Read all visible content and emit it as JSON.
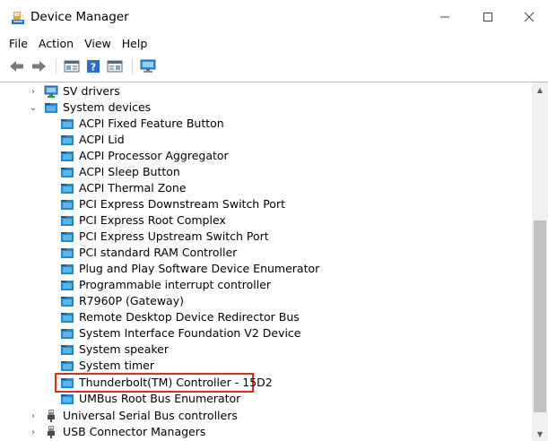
{
  "window": {
    "title": "Device Manager",
    "controls": {
      "minimize": "—",
      "maximize": "☐",
      "close": "✕"
    }
  },
  "menu": {
    "items": [
      "File",
      "Action",
      "View",
      "Help"
    ]
  },
  "toolbar": {
    "buttons": [
      "back-icon",
      "forward-icon",
      "properties-icon",
      "help-icon",
      "console-icon",
      "monitor-icon"
    ]
  },
  "tree": {
    "rows": [
      {
        "label": "SV drivers",
        "level": 0,
        "expander": "collapsed",
        "icon": "monitor-icon"
      },
      {
        "label": "System devices",
        "level": 0,
        "expander": "expanded",
        "icon": "folder-device-icon"
      },
      {
        "label": "ACPI Fixed Feature Button",
        "level": 1,
        "icon": "device-icon"
      },
      {
        "label": "ACPI Lid",
        "level": 1,
        "icon": "device-icon"
      },
      {
        "label": "ACPI Processor Aggregator",
        "level": 1,
        "icon": "device-icon"
      },
      {
        "label": "ACPI Sleep Button",
        "level": 1,
        "icon": "device-icon"
      },
      {
        "label": "ACPI Thermal Zone",
        "level": 1,
        "icon": "device-icon"
      },
      {
        "label": "PCI Express Downstream Switch Port",
        "level": 1,
        "icon": "device-icon"
      },
      {
        "label": "PCI Express Root Complex",
        "level": 1,
        "icon": "device-icon"
      },
      {
        "label": "PCI Express Upstream Switch Port",
        "level": 1,
        "icon": "device-icon"
      },
      {
        "label": "PCI standard RAM Controller",
        "level": 1,
        "icon": "device-icon"
      },
      {
        "label": "Plug and Play Software Device Enumerator",
        "level": 1,
        "icon": "device-icon"
      },
      {
        "label": "Programmable interrupt controller",
        "level": 1,
        "icon": "device-icon"
      },
      {
        "label": "R7960P (Gateway)",
        "level": 1,
        "icon": "device-icon"
      },
      {
        "label": "Remote Desktop Device Redirector Bus",
        "level": 1,
        "icon": "device-icon"
      },
      {
        "label": "System Interface Foundation V2 Device",
        "level": 1,
        "icon": "device-icon"
      },
      {
        "label": "System speaker",
        "level": 1,
        "icon": "device-icon"
      },
      {
        "label": "System timer",
        "level": 1,
        "icon": "device-icon"
      },
      {
        "label": "Thunderbolt(TM) Controller - 15D2",
        "level": 1,
        "icon": "device-icon",
        "highlighted": true
      },
      {
        "label": "UMBus Root Bus Enumerator",
        "level": 1,
        "icon": "device-icon"
      },
      {
        "label": "Universal Serial Bus controllers",
        "level": 0,
        "expander": "collapsed",
        "icon": "usb-icon"
      },
      {
        "label": "USB Connector Managers",
        "level": 0,
        "expander": "collapsed",
        "icon": "usb-icon"
      }
    ]
  },
  "colors": {
    "highlight_border": "#e02b20",
    "device_icon": "#1e8ad6"
  }
}
